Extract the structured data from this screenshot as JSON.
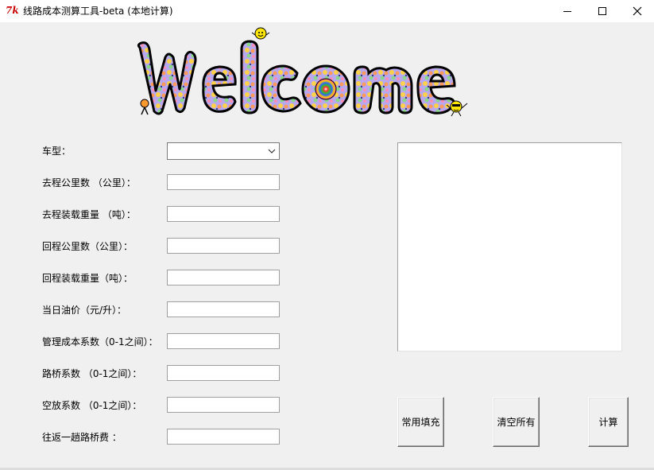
{
  "window": {
    "title": "线路成本测算工具-beta (本地计算)",
    "icon": "tk-feather-icon",
    "icon_text": "7k",
    "controls": [
      "minimize-icon",
      "maximize-icon",
      "close-icon"
    ]
  },
  "banner": {
    "text": "Welcome",
    "style": "multicolor-bubble-letters-with-smiley-faces"
  },
  "form": {
    "vehicle_type": {
      "label": "车型：",
      "value": ""
    },
    "outbound_distance": {
      "label": "去程公里数 （公里）：",
      "value": ""
    },
    "outbound_load": {
      "label": "去程装载重量 （吨）：",
      "value": ""
    },
    "return_distance": {
      "label": "回程公里数（公里）：",
      "value": ""
    },
    "return_load": {
      "label": "回程装载重量（吨）：",
      "value": ""
    },
    "fuel_price": {
      "label": "当日油价（元/升）：",
      "value": ""
    },
    "mgmt_cost_factor": {
      "label": "管理成本系数（0-1之间）：",
      "value": ""
    },
    "bridge_factor": {
      "label": "路桥系数 （0-1之间）：",
      "value": ""
    },
    "empty_factor": {
      "label": "空放系数 （0-1之间）：",
      "value": ""
    },
    "round_trip_toll": {
      "label": "往返一趟路桥费 ：",
      "value": ""
    }
  },
  "output": {
    "text": ""
  },
  "buttons": {
    "fill": "常用填充",
    "clear": "清空所有",
    "calc": "计算"
  },
  "colors": {
    "window_bg": "#f0f0f0",
    "titlebar_bg": "#ffffff",
    "tk_icon": "#c80000"
  }
}
